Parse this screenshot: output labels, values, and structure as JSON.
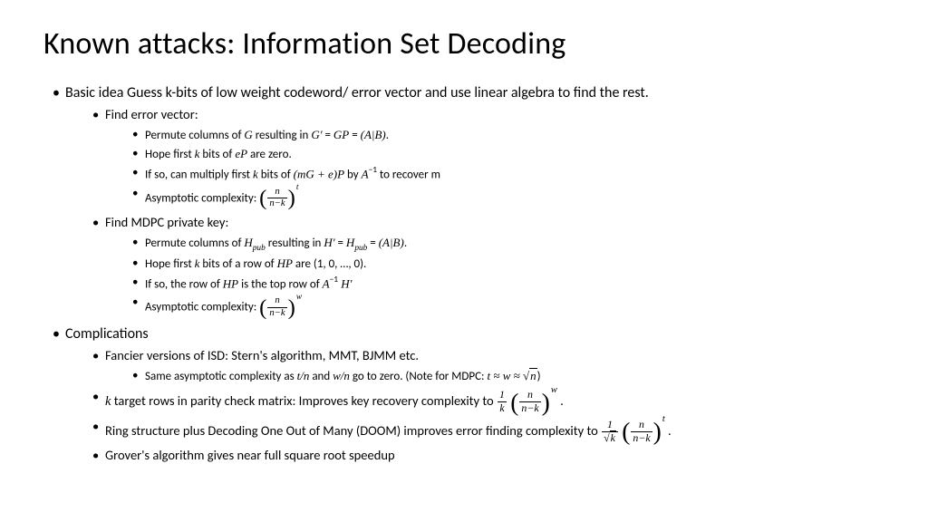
{
  "title": "Known attacks: Information Set Decoding",
  "b1": "Basic idea Guess k-bits of low weight codeword/ error vector and use linear algebra to find the rest.",
  "b1a": "Find error vector:",
  "b1a1_pre": "Permute columns of ",
  "b1a1_G": "G",
  "b1a1_mid": " resulting in ",
  "b1a1_Gp": "G′",
  "b1a1_eq": "  =  ",
  "b1a1_GP": "GP",
  "b1a1_eq2": "  =  ",
  "b1a1_AB": "(A|B)",
  "b1a1_end": ".",
  "b1a2_pre": "Hope first ",
  "b1a2_k": "k",
  "b1a2_mid": " bits of ",
  "b1a2_eP": "eP",
  "b1a2_end": " are zero.",
  "b1a3_pre": "If so, can multiply first ",
  "b1a3_k": "k",
  "b1a3_mid": " bits of ",
  "b1a3_expr": "(mG  +  e)P",
  "b1a3_by": " by ",
  "b1a3_A": "A",
  "b1a3_inv": "−1",
  "b1a3_end": " to recover m",
  "b1a4_pre": "Asymptotic complexity: ",
  "frac_n": "n",
  "frac_nk": "n−k",
  "exp_t": "t",
  "b1b": "Find MDPC private key:",
  "b1b1_pre": "Permute columns of ",
  "b1b1_H": "H",
  "b1b1_sub": "pub",
  "b1b1_mid": " resulting in ",
  "b1b1_Hp": "H′",
  "b1b1_eq": "  =  ",
  "b1b1_eq2": "  =  ",
  "b1b1_AB": "(A|B)",
  "b1b1_end": ".",
  "b1b2_pre": "Hope first ",
  "b1b2_k": "k",
  "b1b2_mid": " bits of a row of ",
  "b1b2_HP": "HP",
  "b1b2_end": " are (1, 0, …, 0).",
  "b1b3_pre": "If so, the row of ",
  "b1b3_HP": "HP",
  "b1b3_mid": " is the top row of ",
  "b1b3_A": "A",
  "b1b3_inv": "−1",
  "b1b3_Hp": " H′",
  "b1b4_pre": "Asymptotic complexity: ",
  "exp_w": "w",
  "b2": "Complications",
  "b2a": "Fancier versions of ISD: Stern's algorithm, MMT, BJMM etc.",
  "b2a1_pre": "Same asymptotic complexity as ",
  "b2a1_tn": "t/n",
  "b2a1_and": " and ",
  "b2a1_wn": "w/n",
  "b2a1_mid": " go to zero. (Note for MDPC: ",
  "b2a1_rel": "t ≈ w ≈ ",
  "b2a1_sq_n": "n",
  "b2a1_end": ")",
  "b2b_k": "k",
  "b2b_mid": " target rows in parity check matrix: Improves  key recovery complexity to ",
  "b2b_1": "1",
  "b2b_end": " .",
  "b2c_pre": "Ring structure plus Decoding One Out of Many (DOOM) improves error finding complexity to ",
  "b2c_end": " .",
  "b2d": "Grover's algorithm gives near full square root speedup"
}
